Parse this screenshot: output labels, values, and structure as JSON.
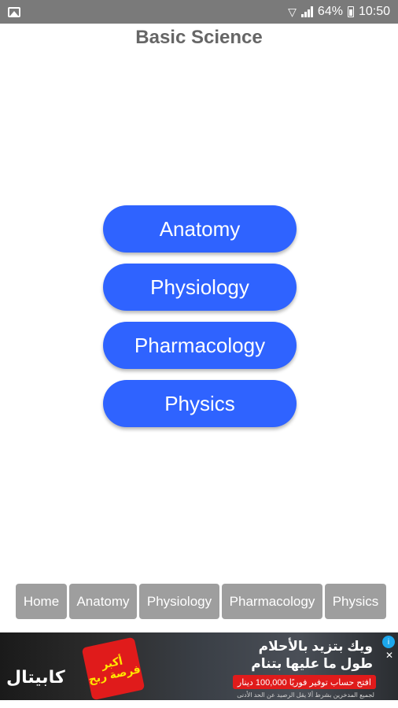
{
  "status_bar": {
    "battery_text": "64%",
    "time": "10:50",
    "icons": [
      "gallery-icon",
      "wifi-icon",
      "signal-icon",
      "battery-icon"
    ]
  },
  "header": {
    "title": "Basic Science"
  },
  "menu": {
    "items": [
      {
        "label": "Anatomy"
      },
      {
        "label": "Physiology"
      },
      {
        "label": "Pharmacology"
      },
      {
        "label": "Physics"
      }
    ]
  },
  "bottom_nav": {
    "tabs": [
      {
        "label": "Home"
      },
      {
        "label": "Anatomy"
      },
      {
        "label": "Physiology"
      },
      {
        "label": "Pharmacology"
      },
      {
        "label": "Physics"
      }
    ]
  },
  "ad": {
    "logo_text": "كابيتال",
    "burst_text": "أكبر فرصة ربح",
    "headline_1": "ويك بتزيد بالأحلام",
    "headline_2": "طول ما عليها بتنام",
    "pill_text": "افتح حساب توفير فوريًا 100,000 دينار",
    "fine_print": "لجميع المدخرين بشرط ألا يقل الرصيد عن الحد الأدنى",
    "icons": [
      "adchoices-icon",
      "close-icon"
    ]
  },
  "colors": {
    "status_bar": "#7a7a7a",
    "button": "#2f63ff",
    "nav_tab": "#9e9e9e",
    "title": "#666666"
  }
}
